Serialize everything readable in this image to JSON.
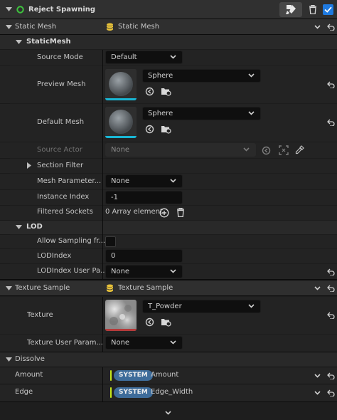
{
  "header": {
    "title": "Reject Spawning",
    "checkbox_checked": true
  },
  "static_mesh": {
    "label": "Static Mesh",
    "value": "Static Mesh",
    "group_label": "StaticMesh",
    "source_mode": {
      "label": "Source Mode",
      "value": "Default"
    },
    "preview_mesh": {
      "label": "Preview Mesh",
      "value": "Sphere"
    },
    "default_mesh": {
      "label": "Default Mesh",
      "value": "Sphere"
    },
    "source_actor": {
      "label": "Source Actor",
      "value": "None"
    },
    "section_filter": {
      "label": "Section Filter"
    },
    "mesh_parameter": {
      "label": "Mesh Parameter...",
      "value": "None"
    },
    "instance_index": {
      "label": "Instance Index",
      "value": "-1"
    },
    "filtered_sockets": {
      "label": "Filtered Sockets",
      "value": "0 Array element"
    }
  },
  "lod": {
    "label": "LOD",
    "allow_sampling": {
      "label": "Allow Sampling fr...",
      "checked": false
    },
    "lod_index": {
      "label": "LODIndex",
      "value": "0"
    },
    "lod_index_user_param": {
      "label": "LODIndex User Pa...",
      "value": "None"
    }
  },
  "texture_sample": {
    "label": "Texture Sample",
    "value": "Texture Sample",
    "texture": {
      "label": "Texture",
      "value": "T_Powder"
    },
    "texture_user_param": {
      "label": "Texture User Param...",
      "value": "None"
    }
  },
  "dissolve": {
    "label": "Dissolve",
    "amount": {
      "label": "Amount",
      "badge": "SYSTEM",
      "value": "Amount"
    },
    "edge": {
      "label": "Edge",
      "badge": "SYSTEM",
      "value": "Edge_Width"
    }
  },
  "colors": {
    "panel": "#242424",
    "subpanel": "#1c1c1c",
    "header": "#2f2f2f",
    "accent_blue": "#3e6c9a",
    "badge_green": "#c7e81a",
    "folder_yellow": "#e8c23a",
    "thumb_underline": "#19b6d4",
    "texture_underline": "#b43a3a",
    "checkbox_blue": "#1f7ae0"
  },
  "icons": [
    "triangle-down-icon",
    "niagara-module-icon",
    "paint-brush-icon",
    "trash-icon",
    "checkbox-icon",
    "chevron-down-icon",
    "reset-arrow-icon",
    "database-icon",
    "browse-arrow-icon",
    "folder-browse-icon",
    "eyedropper-icon",
    "select-actor-icon",
    "plus-circle-icon",
    "triangle-right-icon"
  ]
}
